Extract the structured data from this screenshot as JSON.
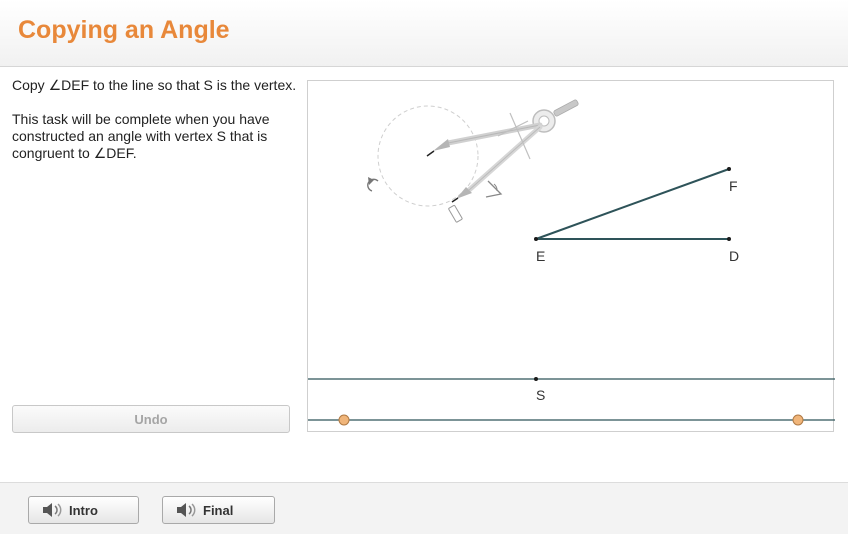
{
  "header": {
    "title": "Copying an Angle"
  },
  "instructions": {
    "line1": "Copy ∠DEF to the line so that S is the vertex.",
    "line2": "This task will be complete when you have constructed an angle with vertex S that is congruent to ∠DEF."
  },
  "undo": {
    "label": "Undo"
  },
  "canvas": {
    "labels": {
      "F": "F",
      "E": "E",
      "D": "D",
      "S": "S"
    },
    "colors": {
      "segment": "#2e5359",
      "point": "#1a1a1a",
      "handle": "#f0b57a",
      "handle_stroke": "#b07a44"
    },
    "icons": [
      "compass-icon",
      "pencil-icon",
      "rotate-icon",
      "angle-icon"
    ]
  },
  "footer": {
    "intro": {
      "label": "Intro",
      "icon": "speaker-icon"
    },
    "final": {
      "label": "Final",
      "icon": "speaker-icon"
    }
  }
}
